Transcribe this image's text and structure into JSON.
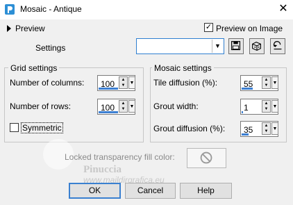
{
  "window": {
    "title": "Mosaic - Antique",
    "close_glyph": "✕"
  },
  "preview": {
    "label": "Preview",
    "preview_on_image_label": "Preview on Image",
    "preview_on_image_checked": true,
    "check_glyph": "✓"
  },
  "settings": {
    "label": "Settings",
    "value": ""
  },
  "toolbar": {
    "icons": [
      "save-icon",
      "randomize-icon",
      "reset-icon"
    ]
  },
  "grid_settings": {
    "title": "Grid settings",
    "columns_label": "Number of columns:",
    "columns_value": "100",
    "rows_label": "Number of rows:",
    "rows_value": "100",
    "symmetric_label": "Symmetric",
    "symmetric_checked": false
  },
  "mosaic_settings": {
    "title": "Mosaic settings",
    "tile_diffusion_label": "Tile diffusion (%):",
    "tile_diffusion_value": "55",
    "grout_width_label": "Grout width:",
    "grout_width_value": "1",
    "grout_diffusion_label": "Grout diffusion (%):",
    "grout_diffusion_value": "35"
  },
  "locked_transparency": {
    "label": "Locked transparency fill color:"
  },
  "buttons": {
    "ok": "OK",
    "cancel": "Cancel",
    "help": "Help"
  },
  "watermark": {
    "name": "Pinuccia",
    "url": "www.maildirgrafica.eu"
  },
  "colors": {
    "accent": "#3c7fd2",
    "window_bg": "#f0f0f0",
    "titlebar_bg": "#ffffff"
  }
}
